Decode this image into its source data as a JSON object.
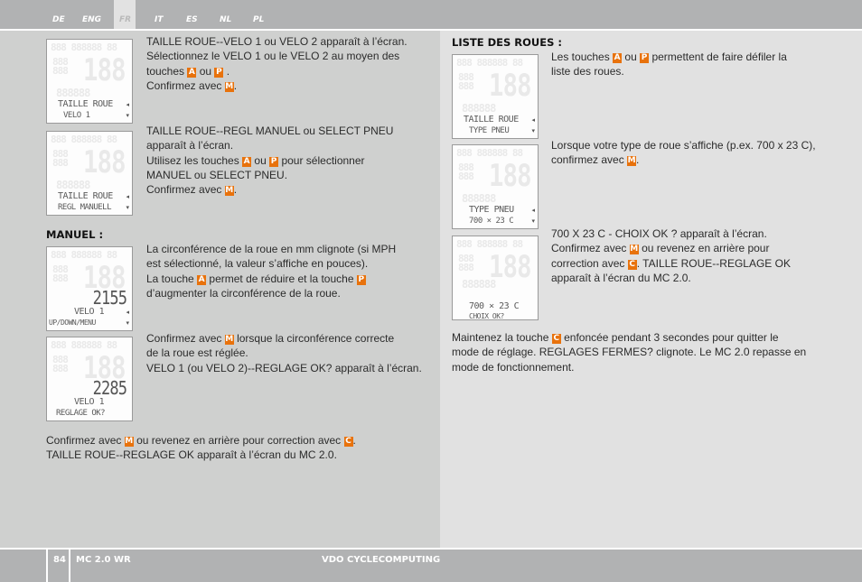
{
  "header": {
    "languages": [
      {
        "code": "DE",
        "active": false
      },
      {
        "code": "ENG",
        "active": false
      },
      {
        "code": "FR",
        "active": true
      },
      {
        "code": "IT",
        "active": false
      },
      {
        "code": "ES",
        "active": false
      },
      {
        "code": "NL",
        "active": false
      },
      {
        "code": "PL",
        "active": false
      }
    ]
  },
  "left": {
    "block1": {
      "screen": {
        "line1": "TAILLE ROUE",
        "line2": "VELO 1"
      },
      "lines": [
        "TAILLE ROUE--VELO 1 ou VELO 2 apparaît à l’écran.",
        "Sélectionnez le VELO 1 ou le VELO 2 au moyen des",
        "touches",
        "ou",
        ".",
        "Confirmez avec",
        "."
      ]
    },
    "block2": {
      "screen": {
        "line1": "TAILLE ROUE",
        "line2": "REGL MANUELL"
      },
      "lines": [
        "TAILLE ROUE--REGL MANUEL ou SELECT PNEU",
        "apparaît à l’écran.",
        "Utilisez les touches",
        "ou",
        "pour sélectionner",
        "MANUEL ou SELECT PNEU.",
        "Confirmez avec",
        "."
      ]
    },
    "manuel_heading": "MANUEL :",
    "block3": {
      "screen": {
        "number": "2155",
        "line1": "VELO 1",
        "line2": "UP/DOWN/MENU"
      },
      "lines": [
        "La circonférence de la roue en mm clignote (si MPH",
        "est sélectionné, la valeur s’affiche en pouces).",
        "La touche",
        "permet de réduire et la touche",
        "d’augmenter la circonférence de la roue."
      ]
    },
    "block4": {
      "screen": {
        "number": "2285",
        "line1": "VELO 1",
        "line2": "REGLAGE OK?"
      },
      "lines": [
        "Confirmez avec",
        "lorsque la circonférence correcte",
        "de la roue est réglée.",
        "VELO 1 (ou VELO 2)--REGLAGE OK? apparaît à l’écran."
      ]
    },
    "closing": [
      "Confirmez avec",
      "ou revenez en arrière pour correction avec",
      ".",
      "TAILLE ROUE--REGLAGE OK apparaît à l’écran du MC 2.0."
    ]
  },
  "right": {
    "heading": "LISTE DES ROUES :",
    "block1": {
      "screen": {
        "line1": "TAILLE ROUE",
        "line2": "TYPE PNEU"
      },
      "lines": [
        "Les touches",
        "ou",
        "permettent de faire défiler la",
        "liste des roues."
      ]
    },
    "block2": {
      "screen": {
        "line1": "TYPE PNEU",
        "line2": "700 × 23 C"
      },
      "lines": [
        "Lorsque votre type de roue s’affiche (p.ex. 700 x 23 C),",
        "confirmez avec",
        "."
      ]
    },
    "block3": {
      "screen": {
        "line1": "700 × 23 C",
        "line2": "CHOIX OK?"
      },
      "lines": [
        "700 X 23 C - CHOIX OK ? apparaît à l’écran.",
        "Confirmez avec",
        "ou revenez en arrière pour",
        "correction avec",
        ". TAILLE ROUE--REGLAGE OK",
        "apparaît à l’écran du MC 2.0."
      ]
    },
    "closing": [
      "Maintenez la touche",
      "enfoncée pendant 3 secondes pour quitter le",
      "mode de réglage. REGLAGES FERMES? clignote. Le MC 2.0 repasse en",
      "mode de fonctionnement."
    ]
  },
  "keys": {
    "A": "A",
    "P": "P",
    "M": "M",
    "C": "C",
    "color": "#e8720c"
  },
  "footer": {
    "page_number": "84",
    "model": "MC 2.0 WR",
    "brand": "VDO CYCLECOMPUTING"
  }
}
